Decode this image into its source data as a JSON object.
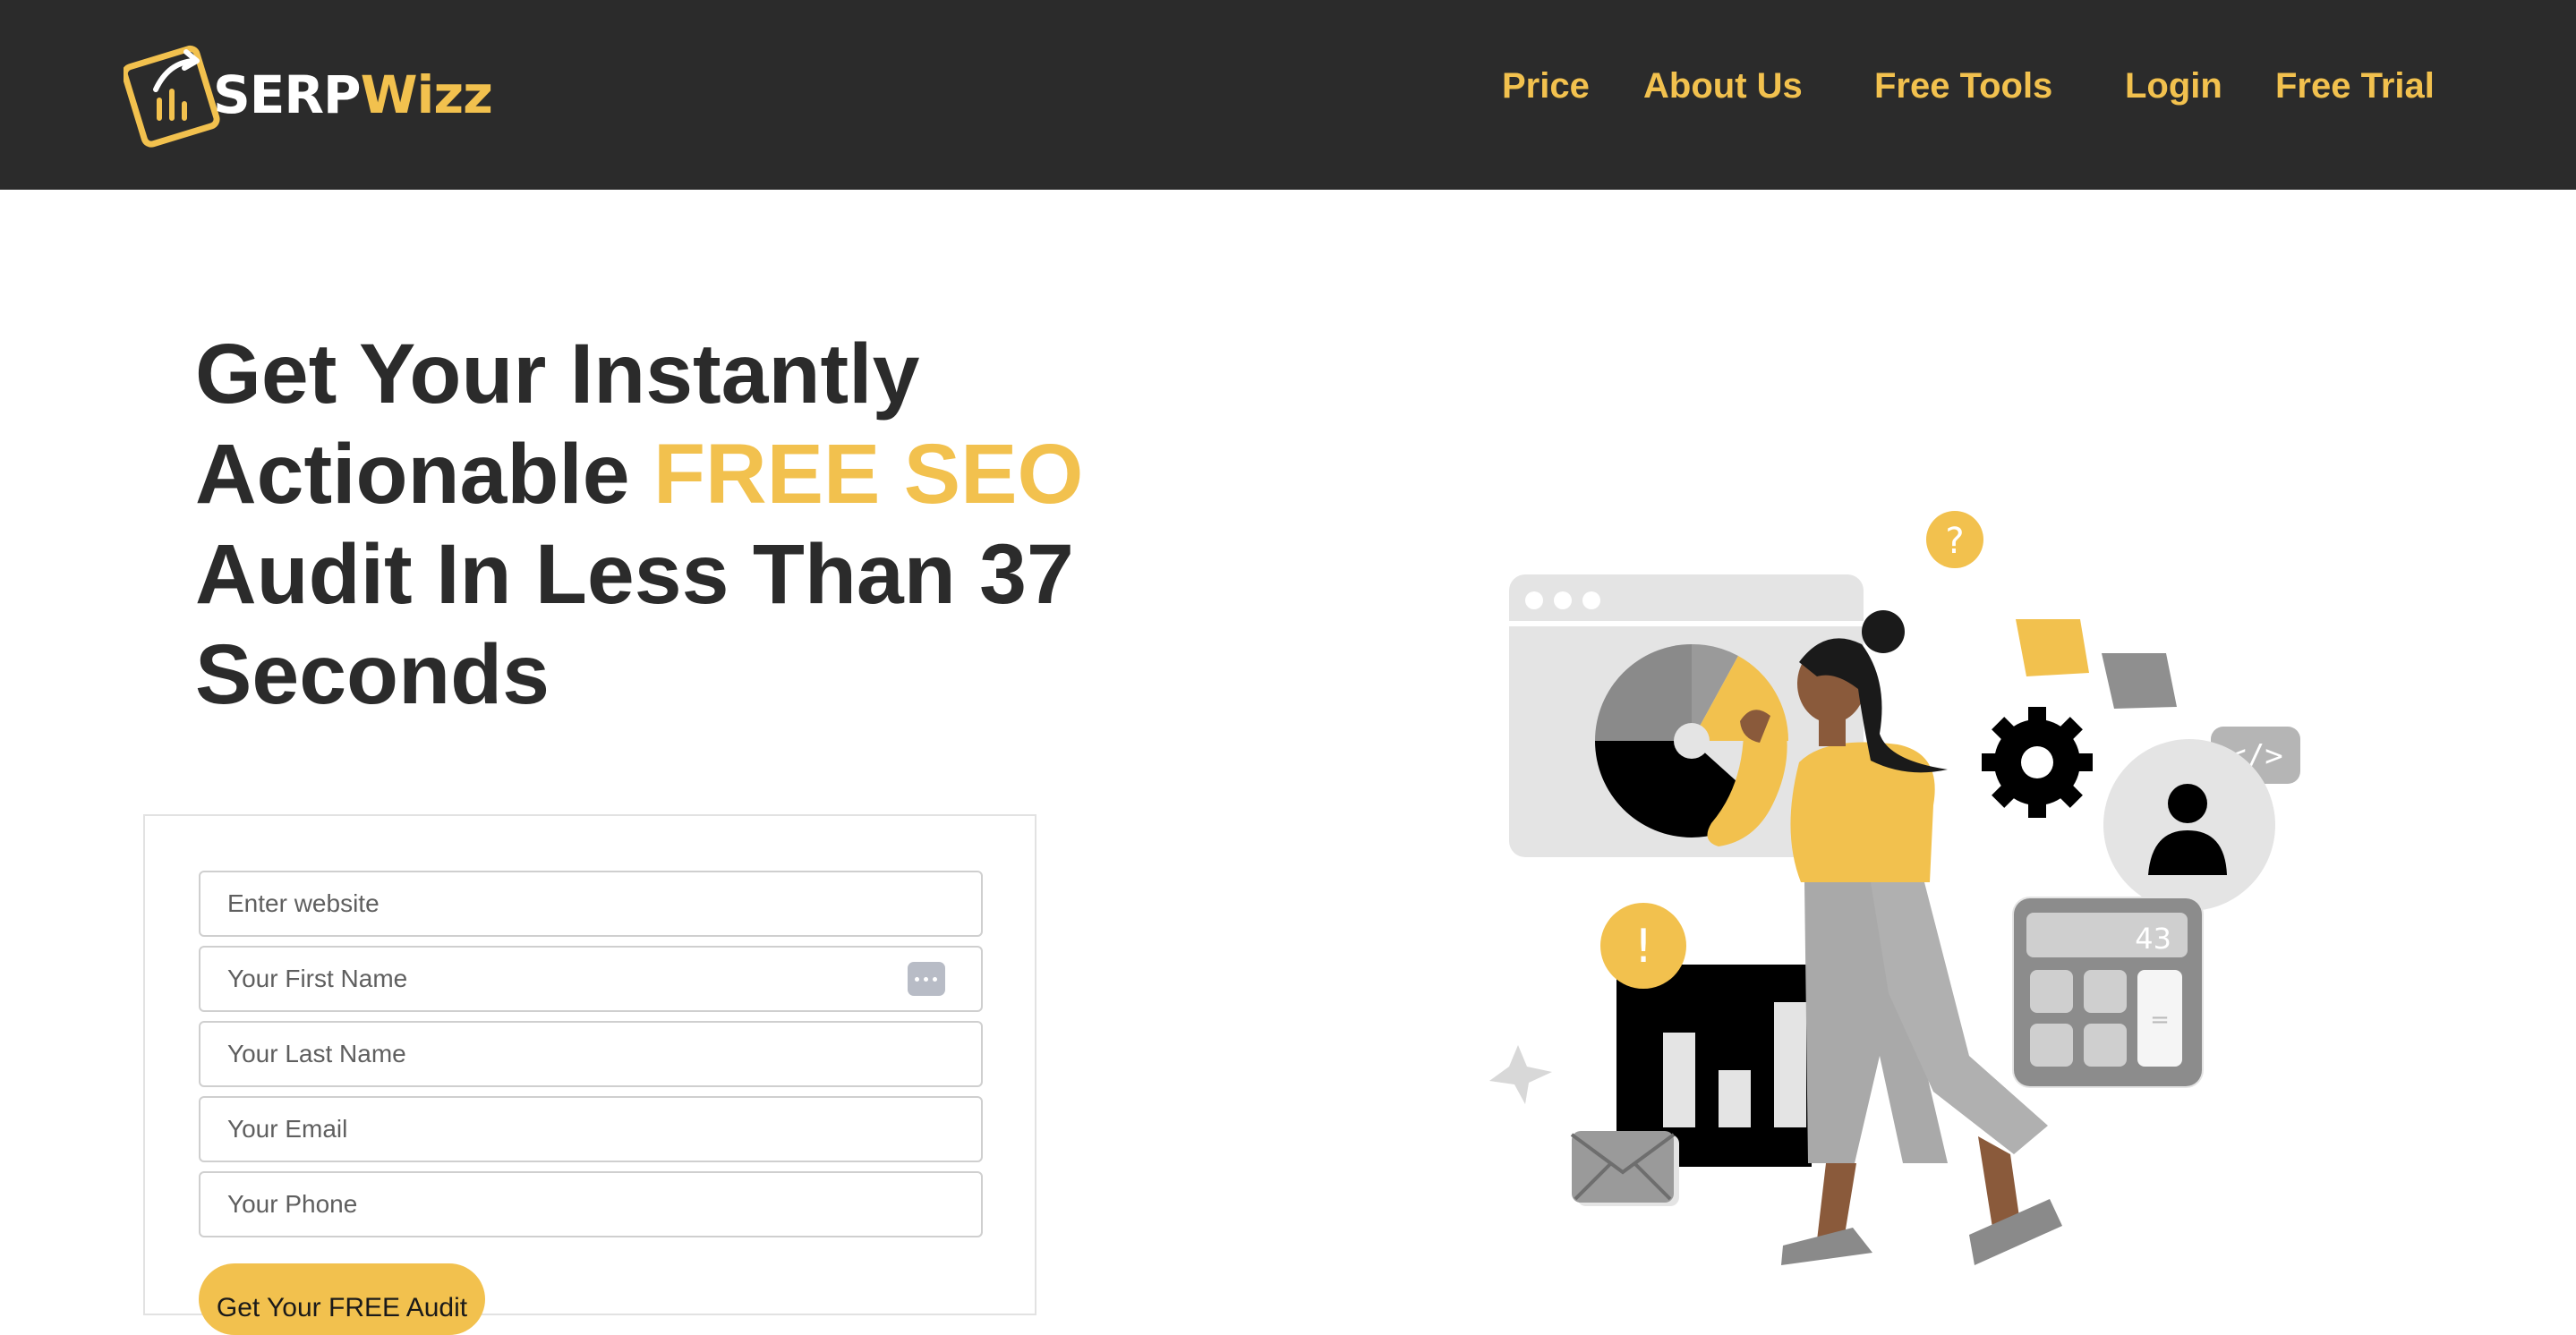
{
  "header": {
    "logo": {
      "part1": "SERP",
      "part2": "Wizz"
    },
    "nav": [
      "Price",
      "About Us",
      "Free Tools",
      "Login",
      "Free Trial"
    ]
  },
  "hero": {
    "title_line1": "Get Your Instantly",
    "title_line2_a": "Actionable ",
    "title_line2_b": "FREE SEO",
    "title_line3": "Audit In Less Than 37",
    "title_line4": "Seconds"
  },
  "form": {
    "website_placeholder": "Enter website",
    "first_name_placeholder": "Your First Name",
    "last_name_placeholder": "Your Last Name",
    "email_placeholder": "Your Email",
    "phone_placeholder": "Your Phone",
    "submit_label": "Get Your FREE Audit"
  },
  "illustration": {
    "calculator_display": "43",
    "calculator_equals": "=",
    "question_mark": "?",
    "exclamation": "!",
    "code_tag": "</>"
  },
  "colors": {
    "brand_yellow": "#f2c14e",
    "header_bg": "#2b2b2b",
    "text_dark": "#2b2b2b"
  },
  "icons": [
    "logo-chart-icon",
    "password-manager-icon",
    "gear-icon",
    "user-icon",
    "mail-icon",
    "star-icon"
  ]
}
